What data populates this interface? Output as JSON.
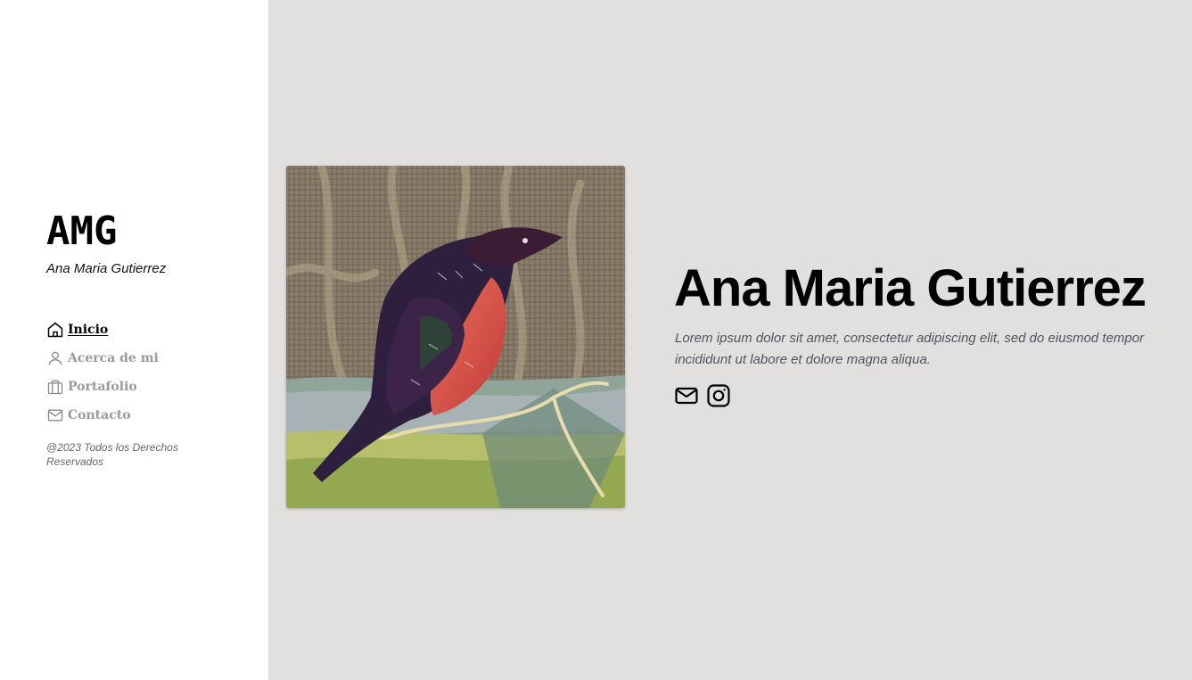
{
  "brand": {
    "logo": "AMG",
    "subtitle": "Ana Maria Gutierrez"
  },
  "nav": {
    "items": [
      {
        "label": "Inicio",
        "icon": "home-icon",
        "active": true
      },
      {
        "label": "Acerca de mi",
        "icon": "user-icon",
        "active": false
      },
      {
        "label": "Portafolio",
        "icon": "briefcase-icon",
        "active": false
      },
      {
        "label": "Contacto",
        "icon": "mail-icon",
        "active": false
      }
    ]
  },
  "footer": {
    "copyright": "@2023 Todos los Derechos Reservados"
  },
  "hero": {
    "title": "Ana Maria Gutierrez",
    "description": "Lorem ipsum dolor sit amet, consectetur adipiscing elit, sed do eiusmod tempor incididunt ut labore et dolore magna aliqua.",
    "socials": [
      {
        "icon": "mail-icon"
      },
      {
        "icon": "instagram-icon"
      }
    ]
  },
  "colors": {
    "page_bg": "#e1e0df",
    "sidebar_bg": "#ffffff",
    "nav_inactive": "#9a9a9a",
    "text_muted": "#4f5560"
  }
}
